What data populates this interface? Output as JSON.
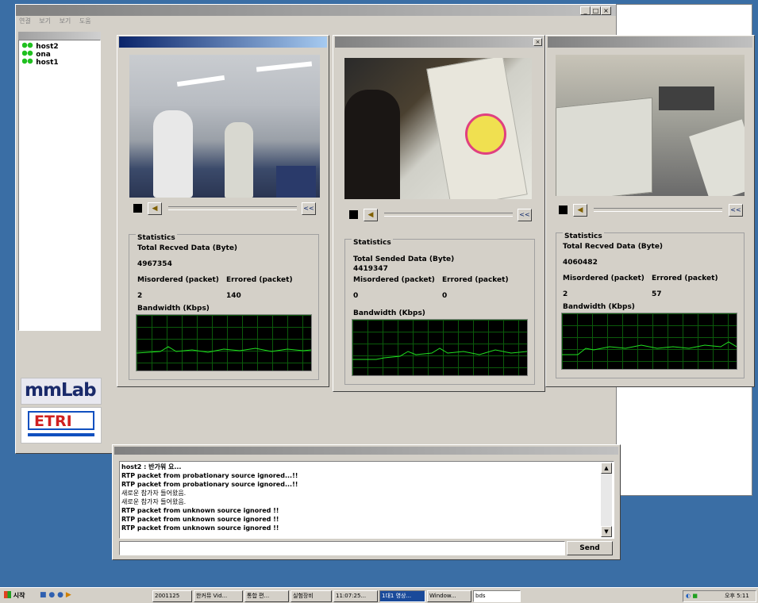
{
  "main_window": {
    "title": "",
    "menu": [
      "연결",
      "보기",
      "보기",
      "도움"
    ]
  },
  "participants": [
    "host2",
    "ona",
    "host1"
  ],
  "logos": {
    "mmlab": "mmLab",
    "etri": "ETRI"
  },
  "panel1": {
    "stats_title": "Statistics",
    "data_label": "Total Recved Data (Byte)",
    "data_value": "4967354",
    "misordered_label": "Misordered (packet)",
    "errored_label": "Errored (packet)",
    "misordered_value": "2",
    "errored_value": "140",
    "bandwidth_label": "Bandwidth (Kbps)"
  },
  "panel2": {
    "stats_title": "Statistics",
    "data_label": "Total Sended Data (Byte)",
    "data_value": "4419347",
    "misordered_label": "Misordered (packet)",
    "errored_label": "Errored (packet)",
    "misordered_value": "0",
    "errored_value": "0",
    "bandwidth_label": "Bandwidth (Kbps)"
  },
  "panel3": {
    "stats_title": "Statistics",
    "data_label": "Total Recved Data (Byte)",
    "data_value": "4060482",
    "misordered_label": "Misordered (packet)",
    "errored_label": "Errored (packet)",
    "misordered_value": "2",
    "errored_value": "57",
    "bandwidth_label": "Bandwidth (Kbps)"
  },
  "chat": {
    "lines": [
      "host2 : 반가워 요...",
      "RTP packet from probationary source ignored...!!",
      "RTP packet from probationary source ignored...!!",
      "새로운 참가자 들어왔음.",
      "새로운 참가자 들어왔음.",
      "RTP packet from unknown source ignored !!",
      "RTP packet from unknown source ignored !!",
      "RTP packet from unknown source ignored !!"
    ],
    "input_value": "",
    "send_label": "Send"
  },
  "taskbar": {
    "start": "시작",
    "buttons": [
      "2001125",
      "한커뮤 Vid...",
      "통합 편...",
      "실험장비",
      "11:07:25...",
      "1대1 영상...",
      "Window...",
      "bds"
    ],
    "clock": "오후 5:11"
  }
}
